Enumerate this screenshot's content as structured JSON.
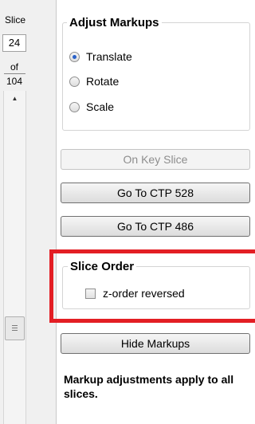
{
  "slice_panel": {
    "label": "Slice",
    "current": "24",
    "of_label": "of",
    "total": "104",
    "scroll_up_icon": "triangle-up",
    "thumb_icon": "grip-lines"
  },
  "adjust_markups": {
    "title": "Adjust Markups",
    "options": [
      {
        "label": "Translate",
        "checked": true
      },
      {
        "label": "Rotate",
        "checked": false
      },
      {
        "label": "Scale",
        "checked": false
      }
    ]
  },
  "buttons": {
    "on_key_slice": "On Key Slice",
    "go_to_ctp_528": "Go To CTP 528",
    "go_to_ctp_486": "Go To CTP 486",
    "hide_markups": "Hide Markups"
  },
  "slice_order": {
    "title": "Slice Order",
    "z_order_reversed_label": "z-order reversed",
    "z_order_reversed_checked": false
  },
  "note": "Markup adjustments apply to all slices.",
  "colors": {
    "highlight": "#e31e24",
    "radio_selected": "#2a62c9"
  }
}
